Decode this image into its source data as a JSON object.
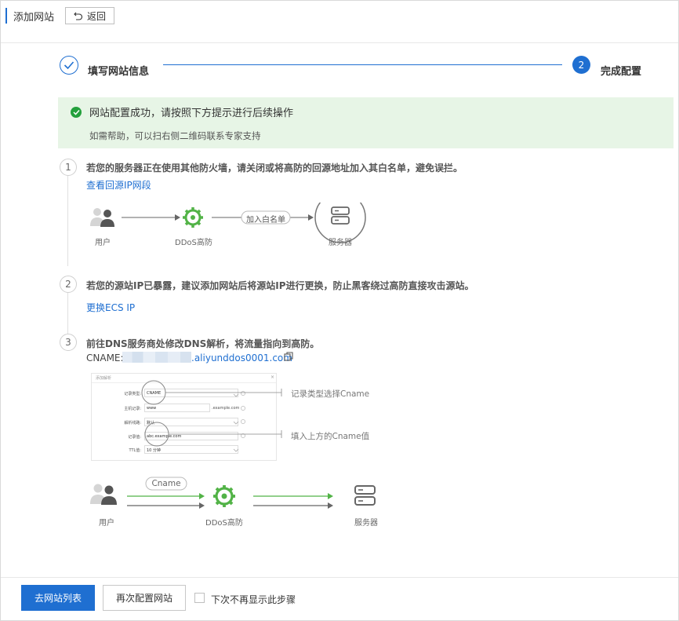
{
  "header": {
    "title": "添加网站",
    "back_label": "返回"
  },
  "steps": [
    {
      "label": "填写网站信息",
      "status": "done"
    },
    {
      "number": "2",
      "label": "完成配置",
      "status": "active"
    }
  ],
  "banner": {
    "title": "网站配置成功，请按照下方提示进行后续操作",
    "subtitle": "如需帮助，可以扫右侧二维码联系专家支持"
  },
  "instructions": [
    {
      "number": "1",
      "text": "若您的服务器正在使用其他防火墙，请关闭或将高防的回源地址加入其白名单，避免误拦。",
      "link": "查看回源IP网段",
      "diagram": {
        "user": "用户",
        "ddos": "DDoS高防",
        "whitelist": "加入白名单",
        "server": "服务器"
      }
    },
    {
      "number": "2",
      "text": "若您的源站IP已暴露，建议添加网站后将源站IP进行更换，防止黑客绕过高防直接攻击源站。",
      "link": "更换ECS IP"
    },
    {
      "number": "3",
      "text": "前往DNS服务商处修改DNS解析，将流量指向到高防。",
      "cname_prefix": "CNAME:",
      "cname_suffix": ".aliyunddos0001.com",
      "dns_form": {
        "title": "添加解析",
        "rows": [
          {
            "label": "记录类型:",
            "value": "CNAME"
          },
          {
            "label": "主机记录:",
            "value": "www",
            "suffix": ".example.com"
          },
          {
            "label": "解析线路:",
            "value": "默认"
          },
          {
            "label": "记录值:",
            "value": "abc.example.com"
          },
          {
            "label": "TTL值:",
            "value": "10 分钟"
          }
        ]
      },
      "callouts": [
        "记录类型选择Cname",
        "填入上方的Cname值"
      ],
      "diagram": {
        "cname": "Cname",
        "user": "用户",
        "ddos": "DDoS高防",
        "server": "服务器"
      }
    }
  ],
  "footer": {
    "primary": "去网站列表",
    "secondary": "再次配置网站",
    "checkbox_label": "下次不再显示此步骤"
  },
  "colors": {
    "accent": "#1f6fd1",
    "success": "#23a03c",
    "ddos_green": "#52b347"
  }
}
